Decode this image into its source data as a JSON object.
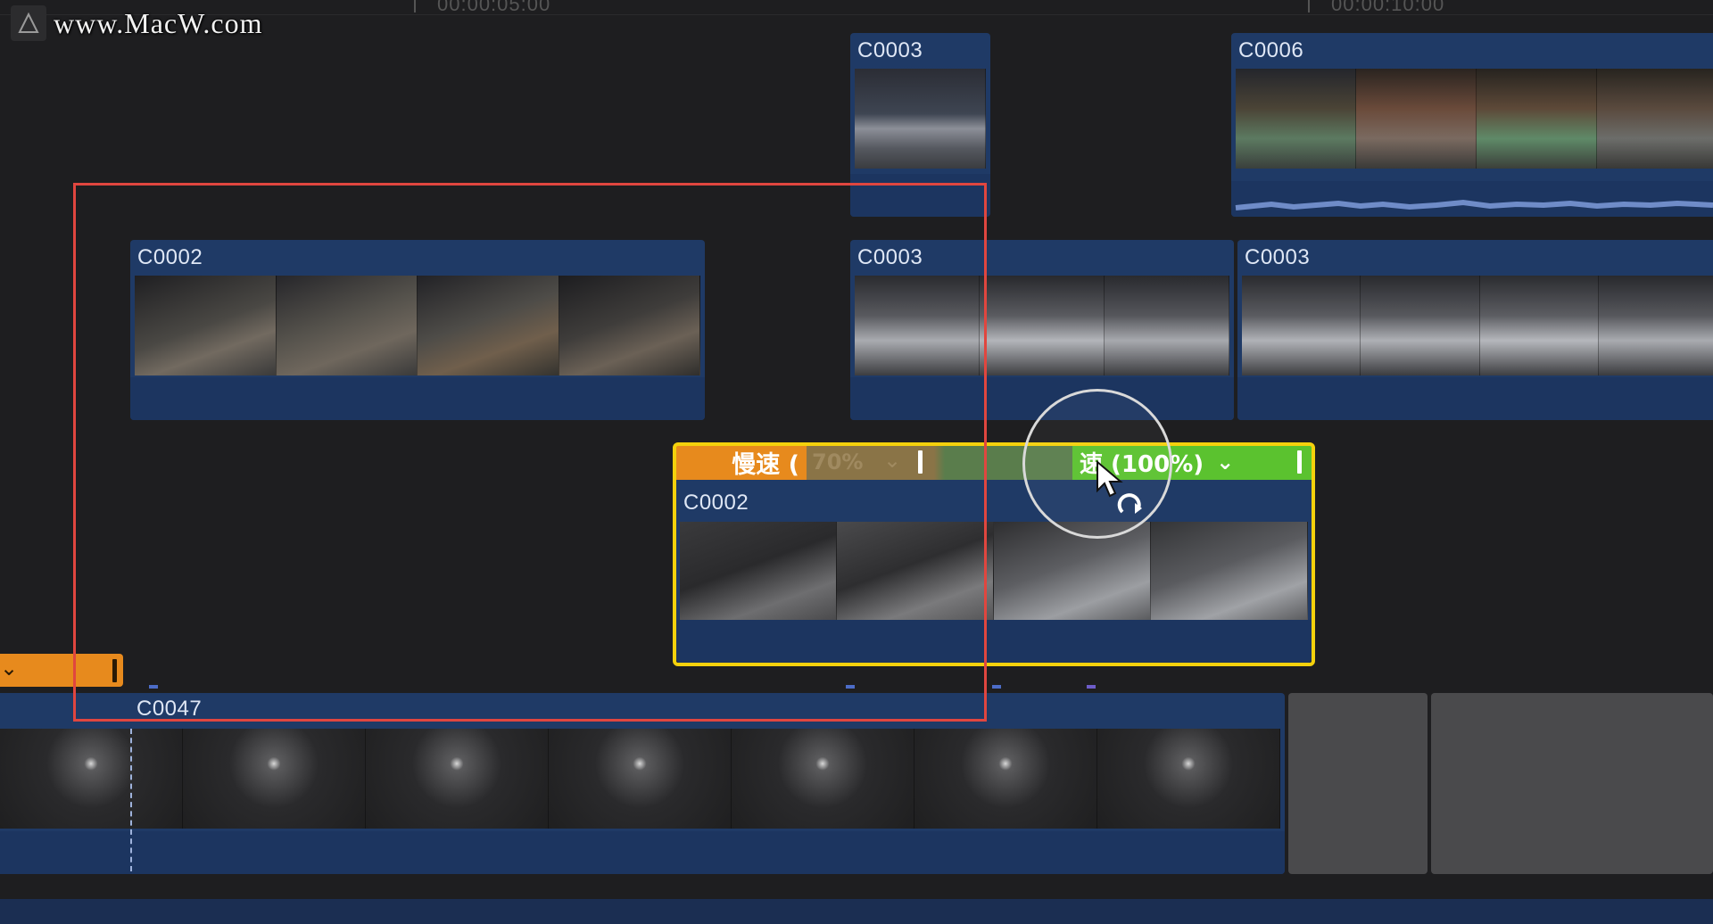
{
  "watermark": {
    "text": "www.MacW.com"
  },
  "ruler": {
    "timecode_1": "00:00:05:00",
    "timecode_2": "00:00:10:00"
  },
  "clips": {
    "c0003_top": {
      "name": "C0003"
    },
    "c0006": {
      "name": "C0006"
    },
    "c0002_upper": {
      "name": "C0002"
    },
    "c0003_mid_a": {
      "name": "C0003"
    },
    "c0003_mid_b": {
      "name": "C0003"
    },
    "c0002_selected": {
      "name": "C0002"
    },
    "c0047": {
      "name": "C0047"
    }
  },
  "speed": {
    "slow_label": "慢速 (",
    "slow_value": "70%",
    "normal_label": "速 (100%)",
    "chevron": "⌄"
  },
  "colors": {
    "clip_blue": "#1f3a66",
    "speed_slow": "#e78a1d",
    "speed_normal": "#5bc22f",
    "selection_yellow": "#f4d10c",
    "marquee_red": "#e0463f"
  },
  "icons": {
    "speed_handle": "retime-handle-icon",
    "cursor": "pointer-arrow-icon",
    "retime_cursor": "retime-cursor-icon"
  }
}
